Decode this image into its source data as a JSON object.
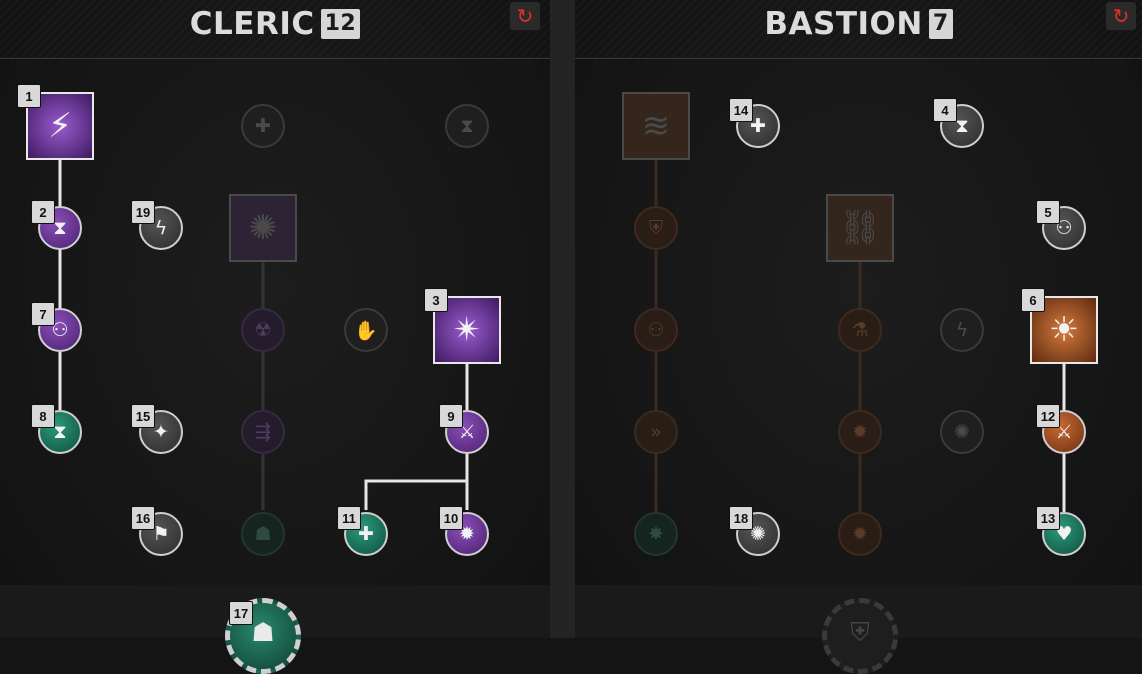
{
  "left": {
    "title": "CLERIC",
    "level": "12",
    "reset_icon": "↻",
    "nodes": [
      {
        "badge": "1",
        "icon": "⚡"
      },
      {
        "badge": "2",
        "icon": "⧗"
      },
      {
        "badge": "19",
        "icon": "ϟ"
      },
      {
        "badge": "7",
        "icon": "⚇"
      },
      {
        "badge": "3",
        "icon": "✴"
      },
      {
        "badge": "8",
        "icon": "⧗"
      },
      {
        "badge": "15",
        "icon": "✦"
      },
      {
        "badge": "9",
        "icon": "⚔"
      },
      {
        "badge": "16",
        "icon": "⚑"
      },
      {
        "badge": "11",
        "icon": "✚"
      },
      {
        "badge": "10",
        "icon": "✹"
      },
      {
        "badge": "17",
        "icon": "☗"
      }
    ],
    "locked_icons": [
      "✚",
      "⧗",
      "✺",
      "☢",
      "✋",
      "⇶",
      "☗"
    ]
  },
  "right": {
    "title": "BASTION",
    "level": "7",
    "reset_icon": "↻",
    "nodes": [
      {
        "badge": "14",
        "icon": "✚"
      },
      {
        "badge": "4",
        "icon": "⧗"
      },
      {
        "badge": "5",
        "icon": "⚇"
      },
      {
        "badge": "6",
        "icon": "☀"
      },
      {
        "badge": "12",
        "icon": "⚔"
      },
      {
        "badge": "18",
        "icon": "✺"
      },
      {
        "badge": "13",
        "icon": "♥"
      }
    ],
    "locked_icons": [
      "≋",
      "⛨",
      "⛓",
      "⚇",
      "⚗",
      "ϟ",
      "»",
      "✹",
      "✺",
      "✸",
      "✹",
      "⛨"
    ]
  },
  "colors": {
    "purple": "#6b3596",
    "green": "#1a6b55",
    "orange": "#9a4a20",
    "reset": "#e0302a"
  }
}
